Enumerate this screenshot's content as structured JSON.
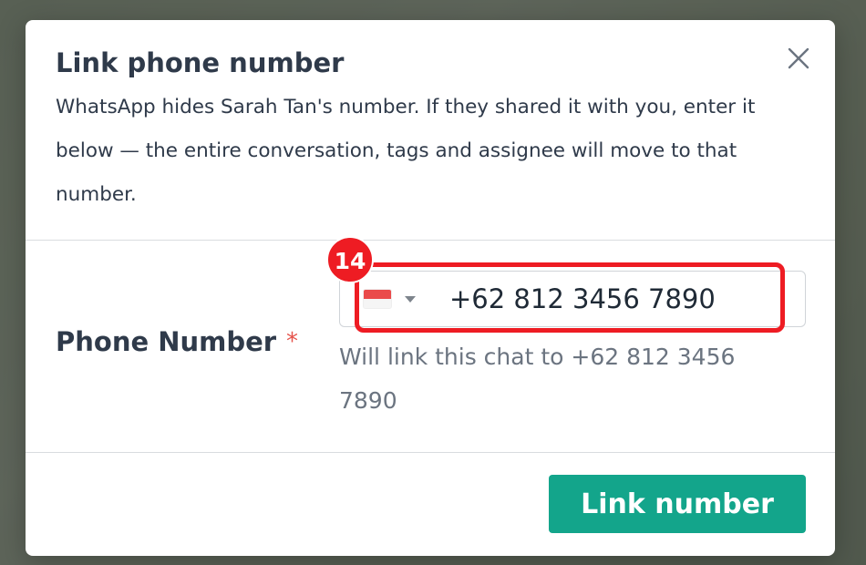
{
  "dialog": {
    "title": "Link phone number",
    "description": "WhatsApp hides Sarah Tan's number. If they shared it with you, enter it below — the entire conversation, tags and assignee will move to that number.",
    "close_icon": "close-icon"
  },
  "form": {
    "phone_label": "Phone Number",
    "required_marker": "*",
    "country_flag_icon": "indonesia-flag-icon",
    "dropdown_icon": "caret-down-icon",
    "phone_value": "+62 812 3456 7890",
    "helper_text": "Will link this chat to +62 812 3456 7890"
  },
  "annotation": {
    "badge_number": "14",
    "highlight_color": "#ee1c23"
  },
  "actions": {
    "submit_label": "Link number",
    "submit_color": "#13a58b"
  }
}
